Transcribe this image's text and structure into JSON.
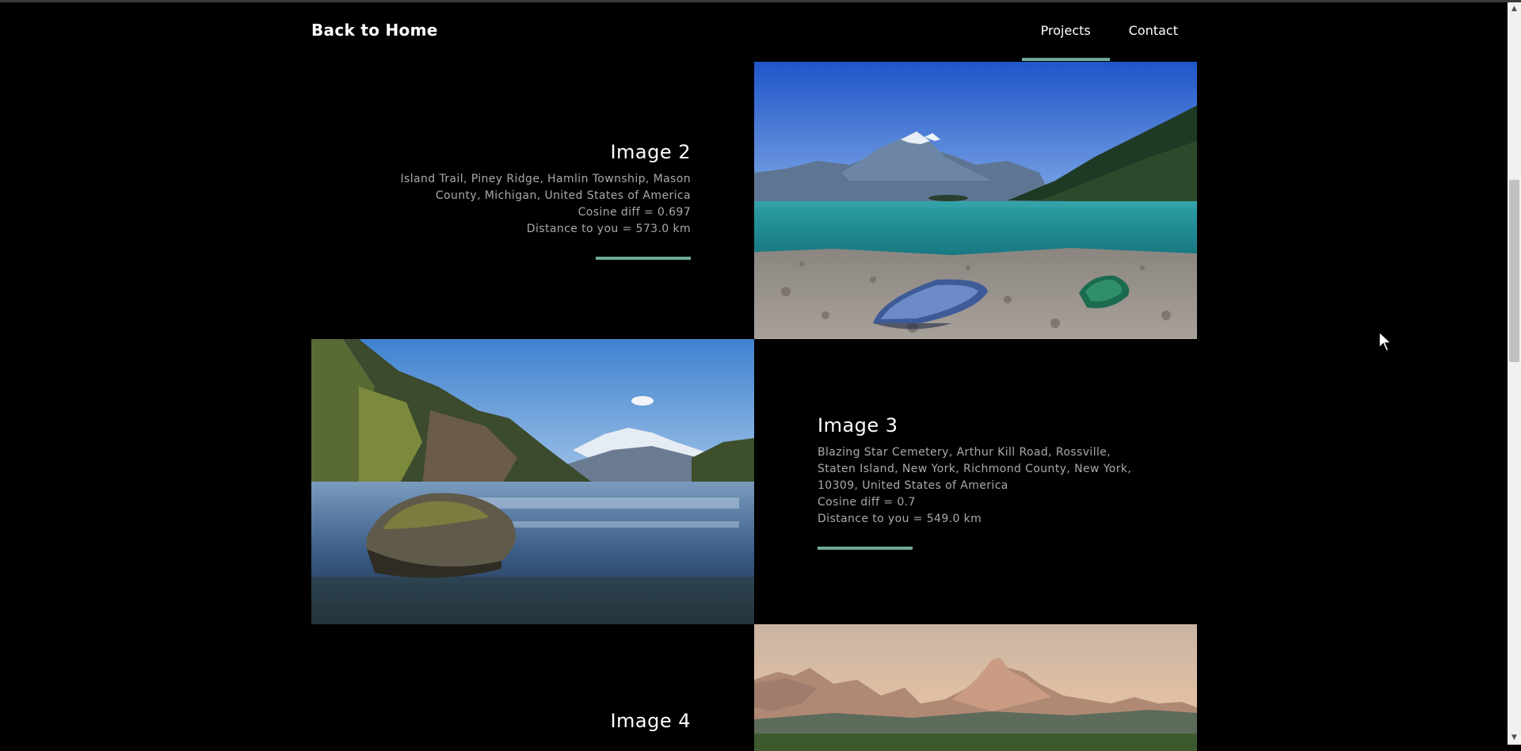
{
  "header": {
    "brand": "Back to Home",
    "nav": [
      {
        "label": "Projects",
        "active": true
      },
      {
        "label": "Contact",
        "active": false
      }
    ],
    "accent": "#6fa898"
  },
  "items": [
    {
      "title": "Image 2",
      "lines": [
        "Island Trail, Piney Ridge, Hamlin Township, Mason",
        "County, Michigan, United States of America",
        "Cosine diff = 0.697",
        "Distance to you = 573.0 km"
      ],
      "image": "lake with mountains and boats on pebble beach"
    },
    {
      "title": "Image 3",
      "lines": [
        "Blazing Star Cemetery, Arthur Kill Road, Rossville,",
        "Staten Island, New York, Richmond County, New York,",
        "10309, United States of America",
        "Cosine diff = 0.7",
        "Distance to you = 549.0 km"
      ],
      "image": "fjord river with rock and mountains"
    },
    {
      "title": "Image 4",
      "lines": [],
      "image": "alpine mountains at sunset"
    }
  ]
}
